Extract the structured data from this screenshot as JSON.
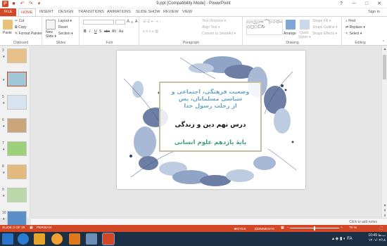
{
  "window": {
    "title": "9.ppt [Compatibility Mode] - PowerPoint",
    "help": "?",
    "minimize": "─",
    "restore": "□",
    "close": "✕"
  },
  "qat": {
    "save": "■",
    "undo": "↶",
    "redo": "↷",
    "start": "▾"
  },
  "tabs": {
    "file": "FILE",
    "home": "HOME",
    "insert": "INSERT",
    "design": "DESIGN",
    "transitions": "TRANSITIONS",
    "animations": "ANIMATIONS",
    "slideshow": "SLIDE SHOW",
    "review": "REVIEW",
    "view": "VIEW",
    "signin": "Sign in"
  },
  "ribbon": {
    "clipboard": {
      "label": "Clipboard",
      "paste": "Paste",
      "cut": "Cut",
      "copy": "Copy",
      "painter": "Format Painter"
    },
    "slides": {
      "label": "Slides",
      "new_slide": "New",
      "new_slide2": "Slide ▾",
      "layout": "Layout ▾",
      "reset": "Reset",
      "section": "Section ▾"
    },
    "font": {
      "label": "Font",
      "bold": "B",
      "italic": "I",
      "underline": "U",
      "shadow": "S",
      "strike": "abc",
      "spacing": "AV",
      "case": "Aa",
      "grow": "A",
      "shrink": "A",
      "clear": "A"
    },
    "paragraph": {
      "label": "Paragraph",
      "text_direction": "Text Direction ▾",
      "align_text": "Align Text ▾",
      "smartart": "Convert to SmartArt ▾"
    },
    "drawing": {
      "label": "Drawing",
      "arrange": "Arrange",
      "quick_styles": "Quick",
      "quick_styles2": "Styles ▾",
      "fill": "Shape Fill ▾",
      "outline": "Shape Outline ▾",
      "effects": "Shape Effects ▾"
    },
    "editing": {
      "label": "Editing",
      "find": "Find",
      "replace": "Replace ▾",
      "select": "Select ▾"
    }
  },
  "thumbnails": [
    {
      "num": "3",
      "star": "★",
      "color": "#e8c08a"
    },
    {
      "num": "",
      "star": "★",
      "color": "#9fc7d8"
    },
    {
      "num": "5",
      "star": "★",
      "color": "#d7e4ef"
    },
    {
      "num": "6",
      "star": "★",
      "color": "#c8a57a"
    },
    {
      "num": "7",
      "star": "★",
      "color": "#9ccf7a"
    },
    {
      "num": "8",
      "star": "★",
      "color": "#e3b97d"
    },
    {
      "num": "9",
      "star": "★",
      "color": "#b9d7a9"
    },
    {
      "num": "10",
      "star": "★",
      "color": "#5b8fc7"
    }
  ],
  "slide": {
    "line1": "وضعیت فرهنگی، اجتماعی و",
    "line2": "سیاسی مسلمانان، پس",
    "line3": "از رحلت رسول خدا",
    "line4": "درس نهم دین و زندگی",
    "line5": "پایهٔ یازدهم علوم انسانی"
  },
  "notes_placeholder": "Click to add notes",
  "status": {
    "slide": "SLIDE 2 OF 25",
    "language": "PERSIAN",
    "notes": "NOTES",
    "comments": "COMMENTS",
    "zoom": "70 %",
    "zoom_minus": "−",
    "zoom_plus": "+",
    "zoom_level": 0.5
  },
  "taskbar": {
    "time": "10:49 ب.ظ",
    "date": "۱۴۰۱/۰۴/۱۸",
    "lang": "FA"
  },
  "colors": {
    "accent": "#d24726",
    "taskbar": "#1c2f45"
  }
}
